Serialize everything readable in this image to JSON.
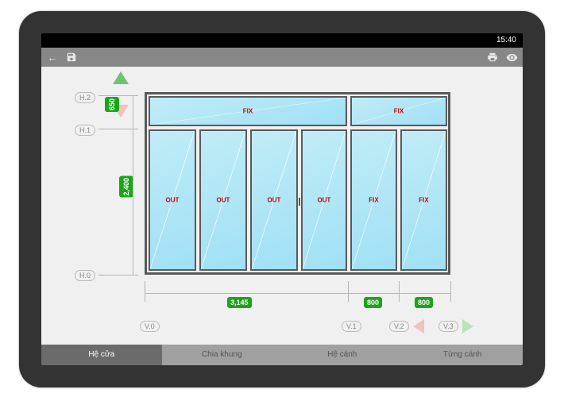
{
  "status": {
    "time": "15:40"
  },
  "appbar": {
    "back": "←",
    "save": "save-icon",
    "print": "print-icon",
    "eye": "eye-icon"
  },
  "tabs": [
    {
      "label": "Hệ cửa",
      "active": true
    },
    {
      "label": "Chia khung",
      "active": false
    },
    {
      "label": "Hệ cánh",
      "active": false
    },
    {
      "label": "Từng cánh",
      "active": false
    }
  ],
  "drawing": {
    "h_ticks": [
      "H.2",
      "H.1",
      "H.0"
    ],
    "v_ticks": [
      "V.0",
      "V.1",
      "V.2",
      "V.3"
    ],
    "dims": {
      "height_total": "2,400",
      "height_top": "650",
      "width_main": "3,145",
      "width_r1": "800",
      "width_r2": "800"
    },
    "top_panels": [
      "FIX",
      "FIX"
    ],
    "bottom_panels": [
      "OUT",
      "OUT",
      "OUT",
      "OUT",
      "FIX",
      "FIX"
    ]
  },
  "colors": {
    "accent": "#19a619",
    "danger": "#c80000",
    "frame": "#5a5a5a"
  },
  "navbar": [
    "home-icon",
    "search-icon",
    "apps-icon",
    "back-icon",
    "sound-icon"
  ]
}
